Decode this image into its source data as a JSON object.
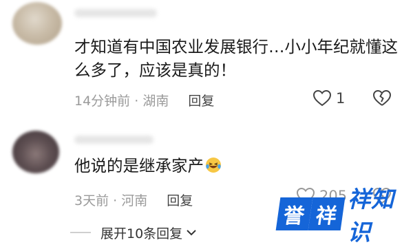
{
  "comments": [
    {
      "text": "才知道有中国农业发展银行…小小年纪就懂这么多了，应该是真的！",
      "time": "14分钟前",
      "location": "湖南",
      "reply_label": "回复",
      "likes": "1"
    },
    {
      "text": "他说的是继承家产",
      "emoji": "laughing-tears-emoji",
      "time": "3天前",
      "location": "河南",
      "reply_label": "回复",
      "likes": "205"
    }
  ],
  "expand_replies_label": "展开10条回复",
  "watermark": {
    "text": "誉祥祥知识",
    "color": "#1565d8"
  },
  "icons": [
    "heart-icon",
    "broken-heart-icon",
    "chevron-down-icon"
  ]
}
